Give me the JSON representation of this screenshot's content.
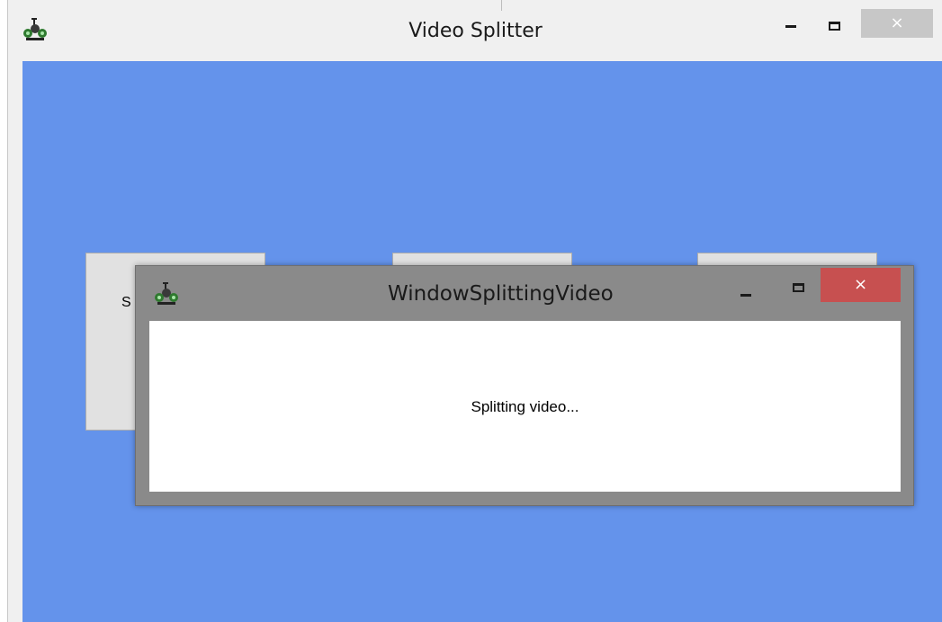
{
  "main_window": {
    "title": "Video Splitter",
    "icon": "video-splitter-app-icon",
    "controls": {
      "minimize": "minimize-icon",
      "maximize": "maximize-icon",
      "close_label": "×"
    },
    "colors": {
      "client_background": "#6493eb",
      "titlebar": "#f0f0f0",
      "close_inactive": "#c7c7c7"
    },
    "buttons": [
      {
        "label": "S"
      },
      {
        "label": ""
      },
      {
        "label": ""
      }
    ]
  },
  "dialog": {
    "title": "WindowSplittingVideo",
    "icon": "video-splitter-app-icon",
    "message": "Splitting video...",
    "controls": {
      "minimize": "minimize-icon",
      "maximize": "maximize-icon",
      "close_label": "×"
    },
    "colors": {
      "frame": "#8a8a8a",
      "close": "#c75050",
      "content": "#ffffff"
    }
  }
}
